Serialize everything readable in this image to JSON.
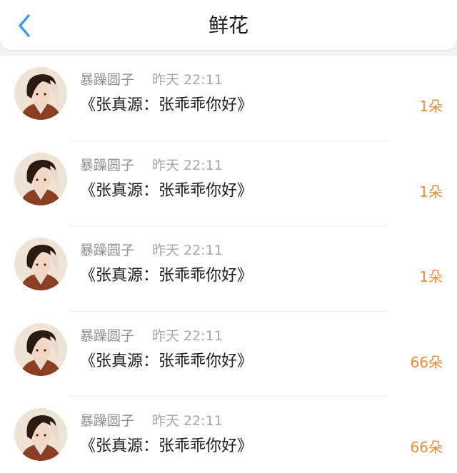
{
  "header": {
    "title": "鲜花",
    "back_icon": "chevron-left-icon",
    "accent_color": "#3a9bf2"
  },
  "count_color": "#f08a38",
  "items": [
    {
      "user": "暴躁圆子",
      "time": "昨天 22:11",
      "message": "《张真源：张乖乖你好》",
      "count": "1朵"
    },
    {
      "user": "暴躁圆子",
      "time": "昨天 22:11",
      "message": "《张真源：张乖乖你好》",
      "count": "1朵"
    },
    {
      "user": "暴躁圆子",
      "time": "昨天 22:11",
      "message": "《张真源：张乖乖你好》",
      "count": "1朵"
    },
    {
      "user": "暴躁圆子",
      "time": "昨天 22:11",
      "message": "《张真源：张乖乖你好》",
      "count": "66朵"
    },
    {
      "user": "暴躁圆子",
      "time": "昨天 22:11",
      "message": "《张真源：张乖乖你好》",
      "count": "66朵"
    }
  ]
}
